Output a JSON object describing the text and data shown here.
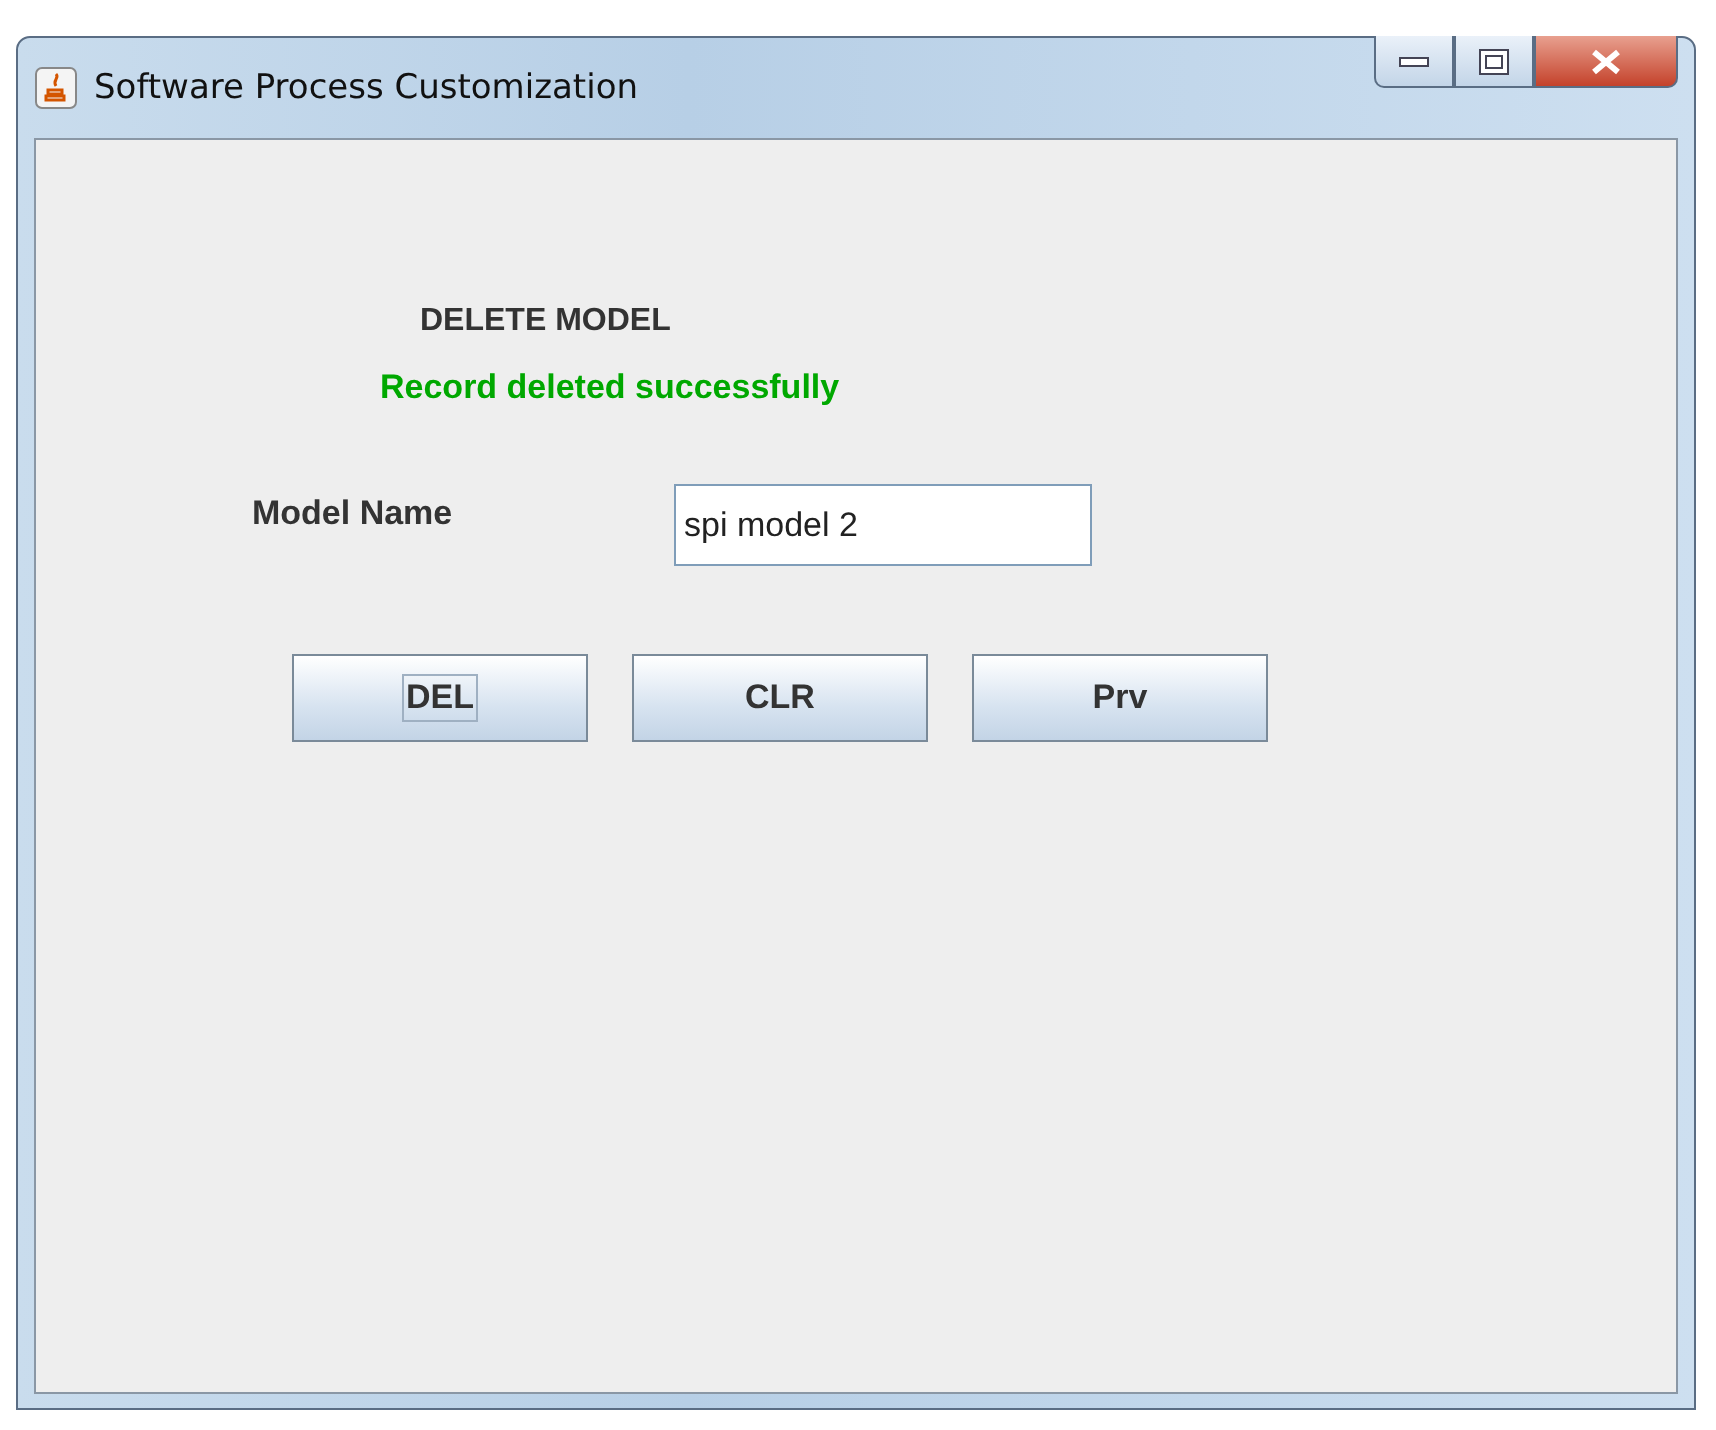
{
  "window": {
    "title": "Software Process Customization"
  },
  "heading": "DELETE MODEL",
  "message": "Record deleted successfully",
  "model_name": {
    "label": "Model Name",
    "value": "spi model 2"
  },
  "buttons": [
    {
      "label": "DEL",
      "focused": true
    },
    {
      "label": "CLR",
      "focused": false
    },
    {
      "label": "Prv",
      "focused": false
    }
  ]
}
